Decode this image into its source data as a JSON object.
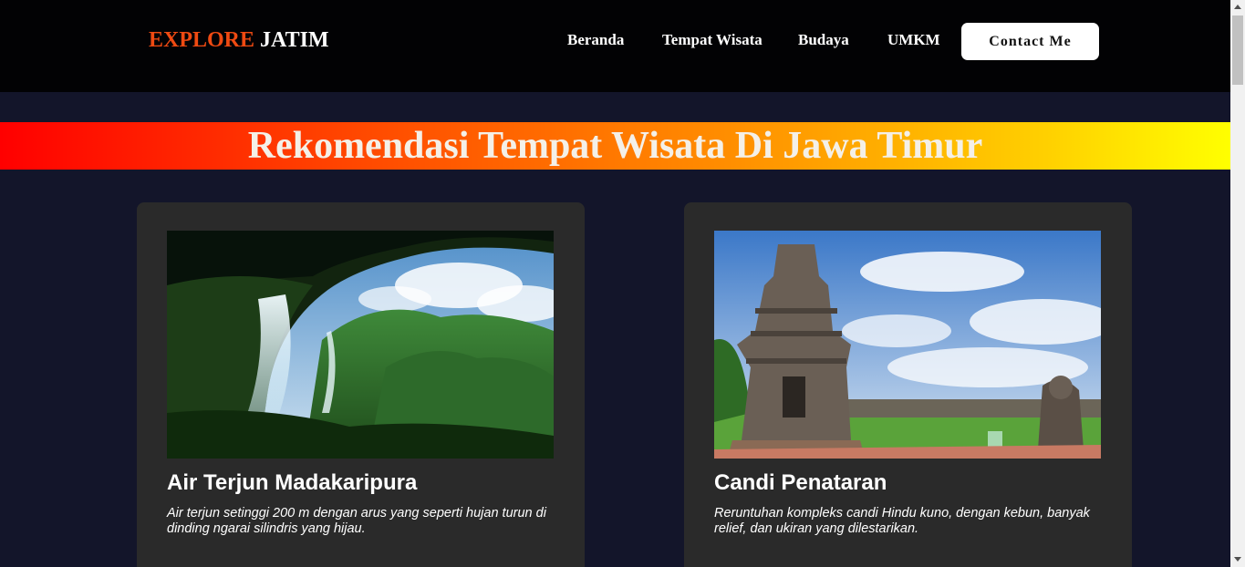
{
  "brand": {
    "part1": "EXPLORE",
    "part2": "JATIM",
    "accent": "#ef4a12"
  },
  "nav": {
    "items": [
      {
        "label": "Beranda"
      },
      {
        "label": "Tempat Wisata"
      },
      {
        "label": "Budaya"
      },
      {
        "label": "UMKM"
      }
    ],
    "contact_label": "Contact Me"
  },
  "banner": {
    "title": "Rekomendasi Tempat Wisata Di Jawa Timur"
  },
  "cards": [
    {
      "title": "Air Terjun Madakaripura",
      "description": "Air terjun setinggi 200 m dengan arus yang seperti hujan turun di dinding ngarai silindris yang hijau.",
      "image_icon": "waterfall-photo"
    },
    {
      "title": "Candi Penataran",
      "description": "Reruntuhan kompleks candi Hindu kuno, dengan kebun, banyak relief, dan ukiran yang dilestarikan.",
      "image_icon": "temple-photo"
    }
  ],
  "colors": {
    "background": "#13152a",
    "navbar": "#020204",
    "card": "#2a2a2a",
    "banner_gradient": [
      "#ff0000",
      "#ffff00"
    ]
  }
}
